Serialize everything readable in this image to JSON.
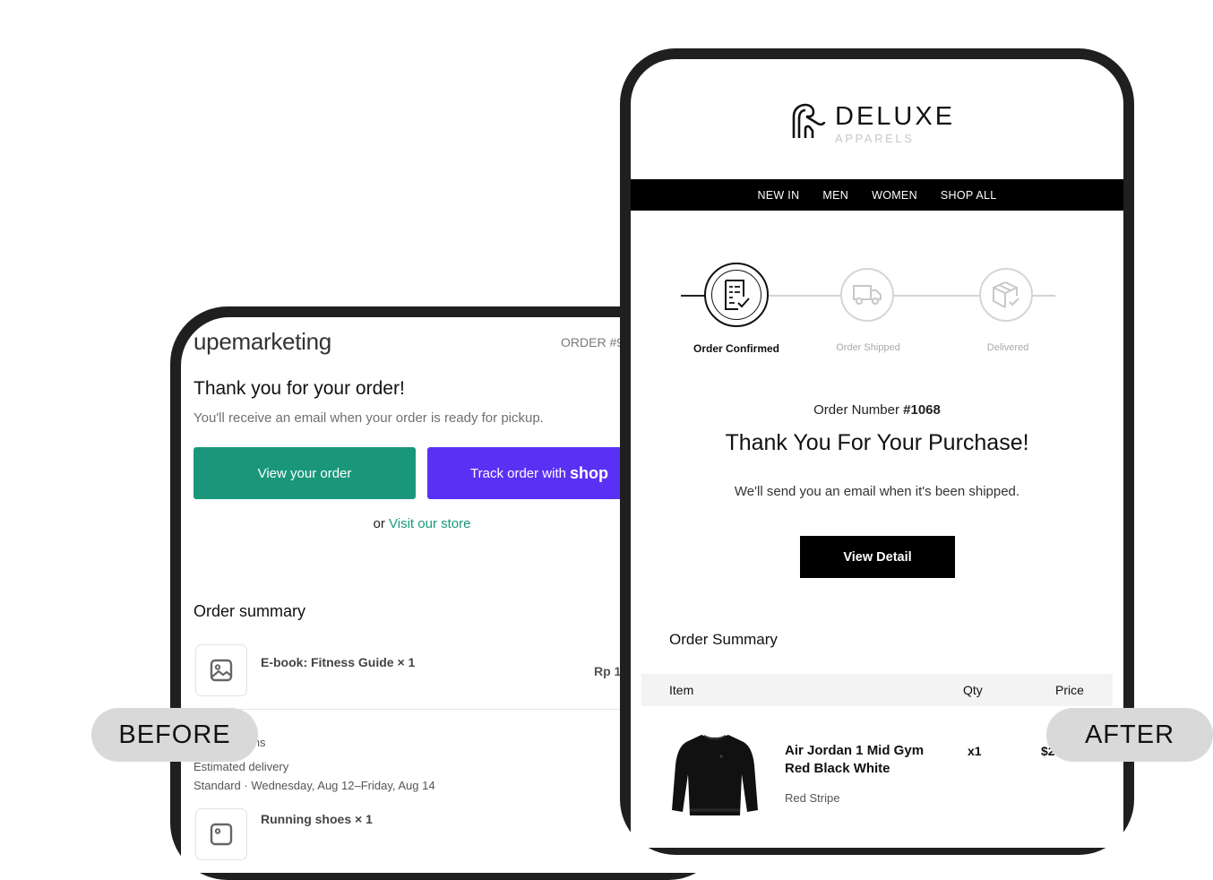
{
  "before": {
    "label": "BEFORE",
    "store_name": "upemarketing",
    "order_number": "ORDER #9",
    "heading": "Thank you for your order!",
    "subtext": "You'll receive an email when your order is ready for pickup.",
    "view_order_button": "View your order",
    "track_order_prefix": "Track order with",
    "track_order_brand": "shop",
    "or_text": "or",
    "visit_store_link": "Visit our store",
    "order_summary_title": "Order summary",
    "items": [
      {
        "name": "E-book: Fitness Guide × 1",
        "price": "Rp 1"
      },
      {
        "name": "Running shoes × 1"
      }
    ],
    "items_fragment": "ems",
    "estimated_delivery_label": "Estimated delivery",
    "delivery_detail": "Standard · Wednesday, Aug 12–Friday, Aug 14",
    "colors": {
      "primary": "#1a977b",
      "shop": "#5a31f4"
    }
  },
  "after": {
    "label": "AFTER",
    "brand_name": "DELUXE",
    "brand_sub": "APPARELS",
    "nav": [
      "NEW IN",
      "MEN",
      "WOMEN",
      "SHOP ALL"
    ],
    "steps": [
      {
        "label": "Order Confirmed",
        "icon": "checklist-icon",
        "active": true
      },
      {
        "label": "Order Shipped",
        "icon": "truck-icon",
        "active": false
      },
      {
        "label": "Delivered",
        "icon": "package-check-icon",
        "active": false
      }
    ],
    "order_number_label": "Order Number",
    "order_number_value": "#1068",
    "heading": "Thank You For Your Purchase!",
    "subtext": "We'll send you an email when it's been shipped.",
    "view_detail_button": "View Detail",
    "order_summary_title": "Order Summary",
    "table_headers": {
      "item": "Item",
      "qty": "Qty",
      "price": "Price"
    },
    "product": {
      "name": "Air Jordan 1 Mid Gym Red Black White",
      "variant": "Red Stripe",
      "qty": "x1",
      "price": "$2"
    }
  }
}
